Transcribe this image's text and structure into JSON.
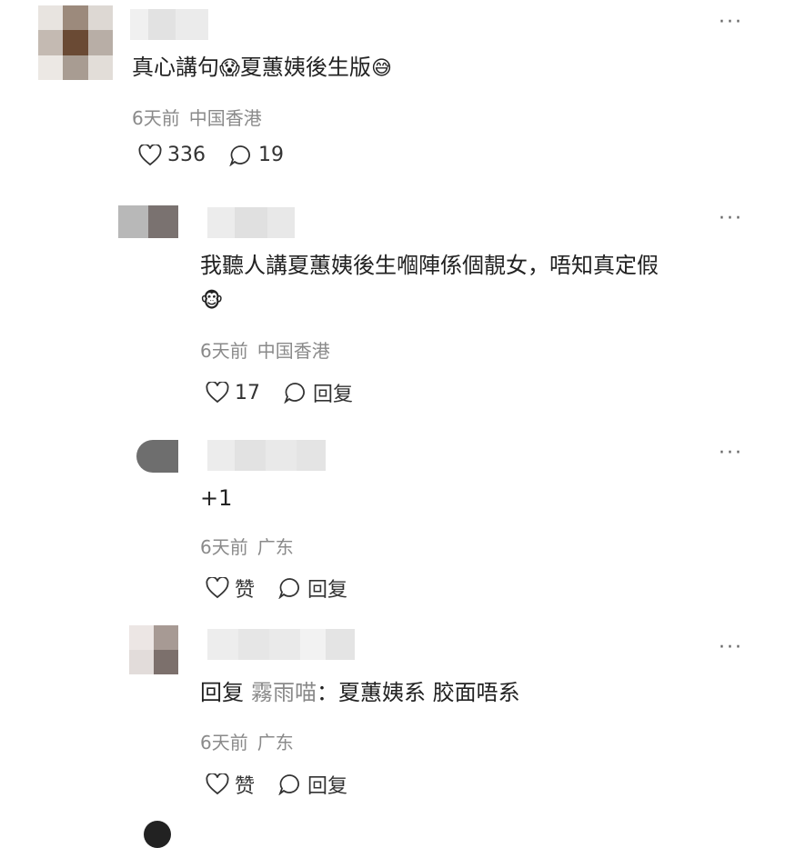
{
  "comments": [
    {
      "text": "真心講句",
      "text_tail": "夏蕙姨後生版",
      "emoji_mid": "😱",
      "emoji_end": "😅",
      "time": "6天前",
      "location": "中国香港",
      "like_label": "336",
      "comment_label": "19"
    },
    {
      "text_line1": "我聽人講夏蕙姨後生嗰陣係個靚女，唔知真定假",
      "emoji": "🐵",
      "time": "6天前",
      "location": "中国香港",
      "like_label": "17",
      "reply_label": "回复"
    },
    {
      "text": "+1",
      "time": "6天前",
      "location": "广东",
      "like_label": "赞",
      "reply_label": "回复"
    },
    {
      "reply_prefix": "回复",
      "reply_to": "霧雨喵",
      "text": "：夏蕙姨系 胶面唔系",
      "time": "6天前",
      "location": "广东",
      "like_label": "赞",
      "reply_label": "回复"
    }
  ],
  "more_label": "···"
}
